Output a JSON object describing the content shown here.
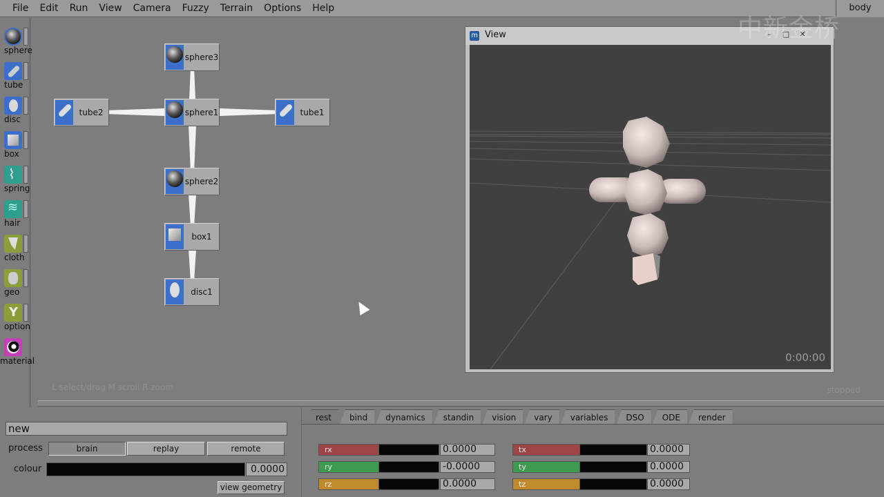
{
  "menu": [
    "File",
    "Edit",
    "Run",
    "View",
    "Camera",
    "Fuzzy",
    "Terrain",
    "Options",
    "Help"
  ],
  "brain_selector": "body",
  "palette": [
    {
      "label": "sphere",
      "icon": "sphere-icon"
    },
    {
      "label": "tube",
      "icon": "tube-icon"
    },
    {
      "label": "disc",
      "icon": "disc-icon"
    },
    {
      "label": "box",
      "icon": "box-icon"
    },
    {
      "label": "spring",
      "icon": "spring-icon"
    },
    {
      "label": "hair",
      "icon": "hair-icon"
    },
    {
      "label": "cloth",
      "icon": "cloth-icon"
    },
    {
      "label": "geo",
      "icon": "geo-icon"
    },
    {
      "label": "option",
      "icon": "option-icon"
    },
    {
      "label": "material",
      "icon": "material-icon"
    }
  ],
  "nodes": {
    "sphere3": "sphere3",
    "tube2": "tube2",
    "sphere1": "sphere1",
    "tube1": "tube1",
    "sphere2": "sphere2",
    "box1": "box1",
    "disc1": "disc1"
  },
  "workspace": {
    "hint": "L  select/drag   M  scroll   R  zoom",
    "status": "stopped"
  },
  "view": {
    "title": "View",
    "time": "0:00:00"
  },
  "watermark": "中新金桥",
  "bottom": {
    "name_value": "new",
    "process_label": "process",
    "process_buttons": [
      "brain",
      "replay",
      "remote"
    ],
    "colour_label": "colour",
    "colour_value": "0.0000",
    "view_geometry": "view geometry"
  },
  "tabs": [
    "rest",
    "bind",
    "dynamics",
    "standin",
    "vision",
    "vary",
    "variables",
    "DSO",
    "ODE",
    "render"
  ],
  "params": {
    "rx": {
      "label": "rx",
      "value": "0.0000"
    },
    "ry": {
      "label": "ry",
      "value": "-0.0000"
    },
    "rz": {
      "label": "rz",
      "value": "0.0000"
    },
    "tx": {
      "label": "tx",
      "value": "0.0000"
    },
    "ty": {
      "label": "ty",
      "value": "0.0000"
    },
    "tz": {
      "label": "tz",
      "value": "0.0000"
    }
  },
  "colors": {
    "node_icon": "#3b6fc9",
    "rx_ry_rz": [
      "#a04545",
      "#3d9a4e",
      "#c08a2d"
    ]
  }
}
